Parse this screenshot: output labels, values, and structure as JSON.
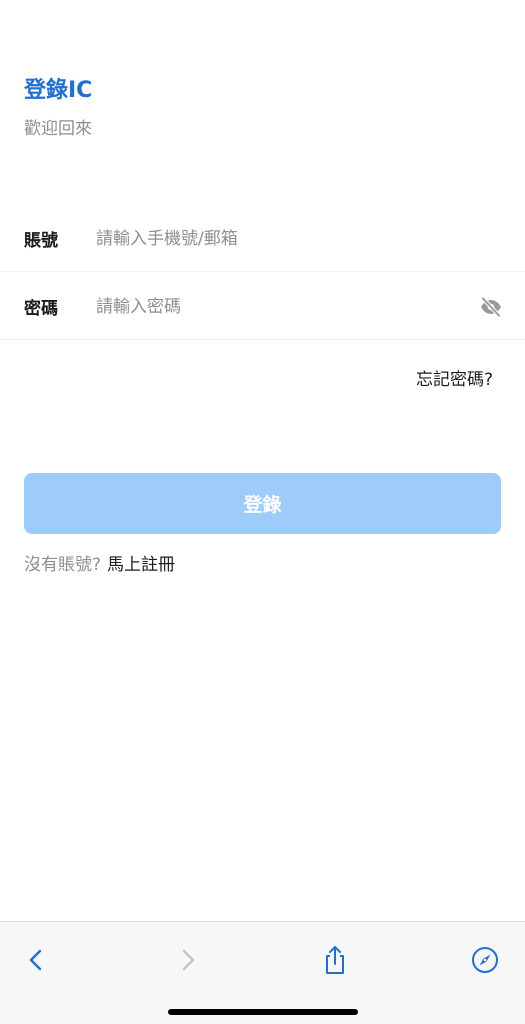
{
  "header": {
    "title": "登錄IC",
    "subtitle": "歡迎回來"
  },
  "form": {
    "account": {
      "label": "賬號",
      "placeholder": "請輸入手機號/郵箱",
      "value": ""
    },
    "password": {
      "label": "密碼",
      "placeholder": "請輸入密碼",
      "value": "",
      "visibility_icon": "eye-off-icon"
    },
    "forgot_label": "忘記密碼?",
    "submit_label": "登錄",
    "register_prompt": "沒有賬號?",
    "register_link": "馬上註冊"
  },
  "browser_toolbar": {
    "icons": [
      "back-icon",
      "forward-icon",
      "share-icon",
      "compass-icon"
    ]
  },
  "colors": {
    "accent": "#1f6fd6",
    "button_disabled": "#9dcbfa",
    "placeholder": "#8e8e93"
  }
}
